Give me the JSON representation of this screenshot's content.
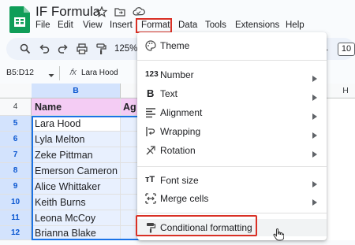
{
  "doc": {
    "title": "IF Formula"
  },
  "menubar": [
    "File",
    "Edit",
    "View",
    "Insert",
    "Format",
    "Data",
    "Tools",
    "Extensions",
    "Help"
  ],
  "toolbar": {
    "zoom": "125%",
    "font_size": "10"
  },
  "formula_bar": {
    "name_box": "B5:D12",
    "value": "Lara Hood"
  },
  "columns": {
    "b": "B",
    "h": "H"
  },
  "header_row": {
    "number": "4",
    "name": "Name",
    "next": "Ag"
  },
  "rows": [
    {
      "num": "5",
      "name": "Lara Hood"
    },
    {
      "num": "6",
      "name": "Lyla Melton"
    },
    {
      "num": "7",
      "name": "Zeke Pittman"
    },
    {
      "num": "8",
      "name": "Emerson Cameron"
    },
    {
      "num": "9",
      "name": "Alice Whittaker"
    },
    {
      "num": "10",
      "name": "Keith Burns"
    },
    {
      "num": "11",
      "name": "Leona McCoy"
    },
    {
      "num": "12",
      "name": "Brianna Blake"
    }
  ],
  "format_menu": {
    "theme": "Theme",
    "number": "Number",
    "text": "Text",
    "alignment": "Alignment",
    "wrapping": "Wrapping",
    "rotation": "Rotation",
    "font_size": "Font size",
    "merge_cells": "Merge cells",
    "conditional_formatting": "Conditional formatting"
  },
  "colors": {
    "accent": "#1a73e8",
    "highlight_box": "#d93025",
    "header_fill": "#f4ccf4",
    "sheets_green": "#0f9d58"
  }
}
